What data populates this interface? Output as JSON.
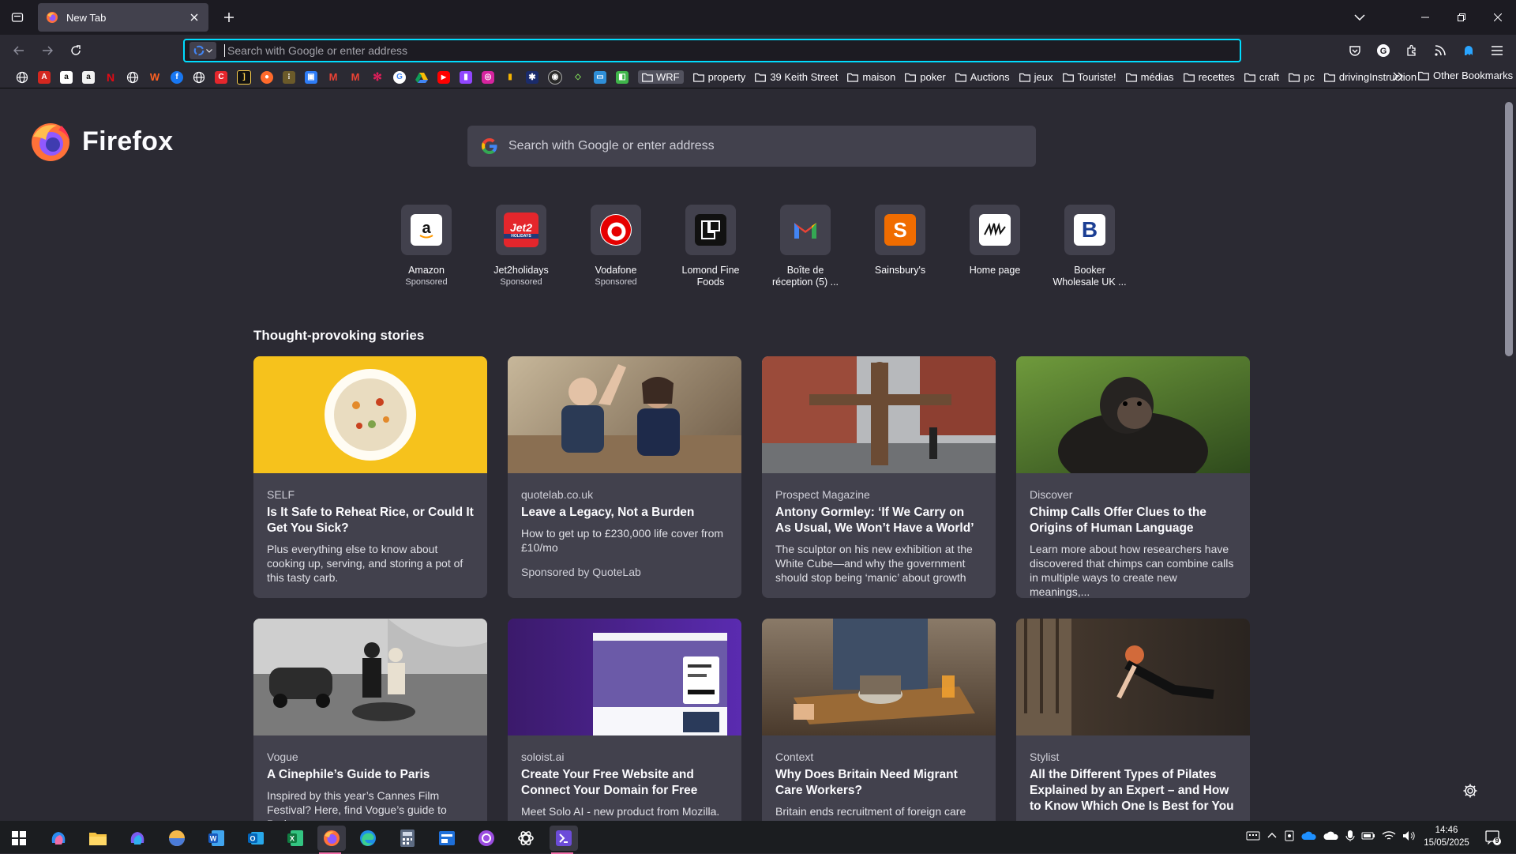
{
  "window": {
    "tab_title": "New Tab",
    "new_tab_icon": "plus-icon"
  },
  "navbar": {
    "url_placeholder": "Search with Google or enter address",
    "url_value": ""
  },
  "bookmarks": {
    "icon_sites": [
      "globe",
      "adobe",
      "amazon",
      "amazon-alt",
      "netflix",
      "globe",
      "wattpad",
      "facebook",
      "globe",
      "c-app",
      "dark-app",
      "cricut",
      "beer-app",
      "teams",
      "gmail",
      "gmail-alt",
      "slack",
      "google",
      "drive",
      "youtube",
      "twitch",
      "instagram",
      "bars",
      "jigsaw",
      "circle-app",
      "diamond",
      "toucan",
      "doc-app"
    ],
    "wrf_label": "WRF",
    "folders": [
      "property",
      "39 Keith Street",
      "maison",
      "poker",
      "Auctions",
      "jeux",
      "Touriste!",
      "médias",
      "recettes",
      "craft",
      "pc",
      "drivingInstruction"
    ],
    "other_label": "Other Bookmarks"
  },
  "home": {
    "brand": "Firefox",
    "search_placeholder": "Search with Google or enter address",
    "top_sites": [
      {
        "name": "Amazon",
        "sponsored": "Sponsored",
        "icon": "amazon-icon"
      },
      {
        "name": "Jet2holidays",
        "sponsored": "Sponsored",
        "icon": "jet2-icon"
      },
      {
        "name": "Vodafone",
        "sponsored": "Sponsored",
        "icon": "vodafone-icon"
      },
      {
        "name": "Lomond Fine Foods",
        "sponsored": "",
        "icon": "lomond-icon"
      },
      {
        "name": "Boîte de réception (5) ...",
        "sponsored": "",
        "icon": "gmail-icon"
      },
      {
        "name": "Sainsbury's",
        "sponsored": "",
        "icon": "sainsburys-icon"
      },
      {
        "name": "Home page",
        "sponsored": "",
        "icon": "homepage-icon"
      },
      {
        "name": "Booker Wholesale UK ...",
        "sponsored": "",
        "icon": "booker-icon"
      }
    ],
    "stories_title": "Thought-provoking stories",
    "stories": [
      {
        "publisher": "SELF",
        "headline": "Is It Safe to Reheat Rice, or Could It Get You Sick?",
        "excerpt": "Plus everything else to know about cooking up, serving, and storing a pot of this tasty carb.",
        "sponsor": ""
      },
      {
        "publisher": "quotelab.co.uk",
        "headline": "Leave a Legacy, Not a Burden",
        "excerpt": "How to get up to £230,000 life cover from £10/mo",
        "sponsor": "Sponsored by QuoteLab"
      },
      {
        "publisher": "Prospect Magazine",
        "headline": "Antony Gormley: ‘If We Carry on As Usual, We Won’t Have a World’",
        "excerpt": "The sculptor on his new exhibition at the White Cube—and why the government should stop being ‘manic’ about growth",
        "sponsor": ""
      },
      {
        "publisher": "Discover",
        "headline": "Chimp Calls Offer Clues to the Origins of Human Language",
        "excerpt": "Learn more about how researchers have discovered that chimps can combine calls in multiple ways to create new meanings,...",
        "sponsor": ""
      },
      {
        "publisher": "Vogue",
        "headline": "A Cinephile’s Guide to Paris",
        "excerpt": "Inspired by this year’s Cannes Film Festival? Here, find Vogue’s guide to Paris",
        "sponsor": ""
      },
      {
        "publisher": "soloist.ai",
        "headline": "Create Your Free Website and Connect Your Domain for Free",
        "excerpt": "Meet Solo AI - new product from Mozilla.",
        "sponsor": ""
      },
      {
        "publisher": "Context",
        "headline": "Why Does Britain Need Migrant Care Workers?",
        "excerpt": "Britain ends recruitment of foreign care",
        "sponsor": ""
      },
      {
        "publisher": "Stylist",
        "headline": "All the Different Types of Pilates Explained by an Expert – and How to Know Which One Is Best for You",
        "excerpt": "",
        "sponsor": ""
      }
    ]
  },
  "taskbar": {
    "apps": [
      "windows-start",
      "copilot",
      "file-explorer",
      "m365",
      "browser-orb",
      "word",
      "outlook",
      "excel",
      "firefox",
      "edge",
      "calculator",
      "news",
      "podcast-app",
      "chatgpt",
      "vs-app"
    ],
    "time": "14:46",
    "date": "15/05/2025",
    "notification_count": "9"
  },
  "colors": {
    "accent": "#00ddff",
    "background": "#2b2a33",
    "card": "#42414d",
    "chrome": "#1c1b22"
  }
}
